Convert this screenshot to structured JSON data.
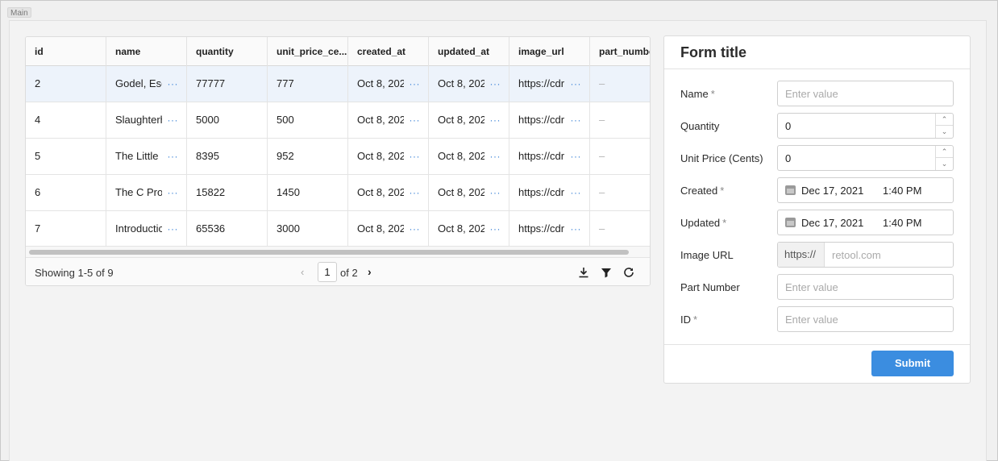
{
  "frame_label": "Main",
  "table": {
    "columns": [
      "id",
      "name",
      "quantity",
      "unit_price_ce...",
      "created_at",
      "updated_at",
      "image_url",
      "part_numbe"
    ],
    "rows": [
      {
        "id": "2",
        "name": "Godel, Esc",
        "quantity": "77777",
        "unit_price": "777",
        "created_at": "Oct 8, 202",
        "updated_at": "Oct 8, 202",
        "image_url": "https://cdr",
        "part_number": "–",
        "selected": true
      },
      {
        "id": "4",
        "name": "Slaughterh",
        "quantity": "5000",
        "unit_price": "500",
        "created_at": "Oct 8, 202",
        "updated_at": "Oct 8, 202",
        "image_url": "https://cdr",
        "part_number": "–",
        "selected": false
      },
      {
        "id": "5",
        "name": "The Little ",
        "quantity": "8395",
        "unit_price": "952",
        "created_at": "Oct 8, 202",
        "updated_at": "Oct 8, 202",
        "image_url": "https://cdr",
        "part_number": "–",
        "selected": false
      },
      {
        "id": "6",
        "name": "The C Prog",
        "quantity": "15822",
        "unit_price": "1450",
        "created_at": "Oct 8, 202",
        "updated_at": "Oct 8, 202",
        "image_url": "https://cdr",
        "part_number": "–",
        "selected": false
      },
      {
        "id": "7",
        "name": "Introductic",
        "quantity": "65536",
        "unit_price": "3000",
        "created_at": "Oct 8, 202",
        "updated_at": "Oct 8, 202",
        "image_url": "https://cdr",
        "part_number": "–",
        "selected": false
      }
    ],
    "more_glyph": "···",
    "footer": {
      "showing": "Showing 1-5 of 9",
      "page": "1",
      "of_total": "of 2",
      "prev_glyph": "‹",
      "next_glyph": "›"
    },
    "tool_icons": [
      "download-icon",
      "filter-icon",
      "refresh-icon"
    ]
  },
  "form": {
    "title": "Form title",
    "required_mark": "*",
    "name": {
      "label": "Name",
      "placeholder": "Enter value"
    },
    "quantity": {
      "label": "Quantity",
      "value": "0"
    },
    "unit_price": {
      "label": "Unit Price (Cents)",
      "value": "0"
    },
    "created": {
      "label": "Created",
      "date": "Dec 17, 2021",
      "time": "1:40 PM"
    },
    "updated": {
      "label": "Updated",
      "date": "Dec 17, 2021",
      "time": "1:40 PM"
    },
    "image_url": {
      "label": "Image URL",
      "prefix": "https://",
      "placeholder": "retool.com"
    },
    "part_number": {
      "label": "Part Number",
      "placeholder": "Enter value"
    },
    "id": {
      "label": "ID",
      "placeholder": "Enter value"
    },
    "submit_label": "Submit",
    "stepper_up": "⌃",
    "stepper_down": "⌄"
  },
  "colors": {
    "accent": "#3b8de0",
    "selected_row": "#edf3fb",
    "link": "#3b82d6"
  }
}
